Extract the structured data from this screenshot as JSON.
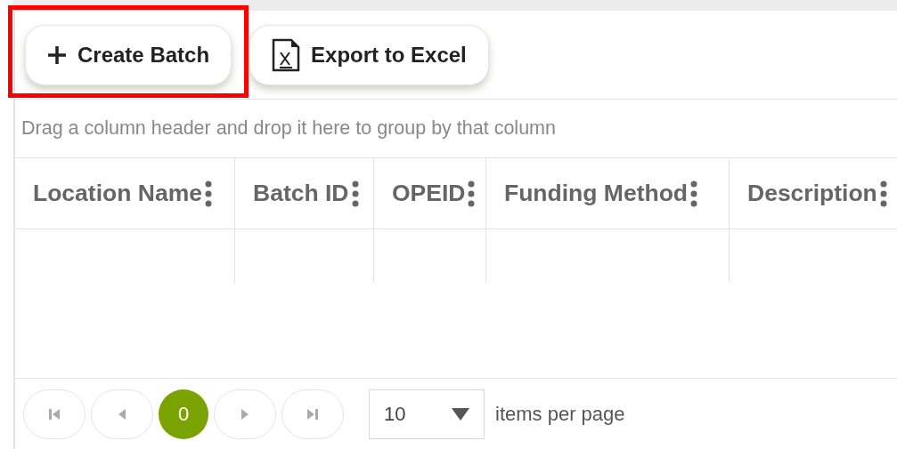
{
  "toolbar": {
    "buttons": [
      {
        "kind": "create",
        "label": "Create Batch",
        "highlighted": true
      },
      {
        "kind": "excel",
        "label": "Export to Excel",
        "highlighted": false
      }
    ]
  },
  "group_panel": {
    "hint": "Drag a column header and drop it here to group by that column"
  },
  "table": {
    "columns": [
      "Location Name",
      "Batch ID",
      "OPEID",
      "Funding Method",
      "Description"
    ]
  },
  "pager": {
    "pages": [
      {
        "label": "0",
        "selected": true
      }
    ],
    "page_size": "10",
    "page_size_label": "items per page"
  }
}
